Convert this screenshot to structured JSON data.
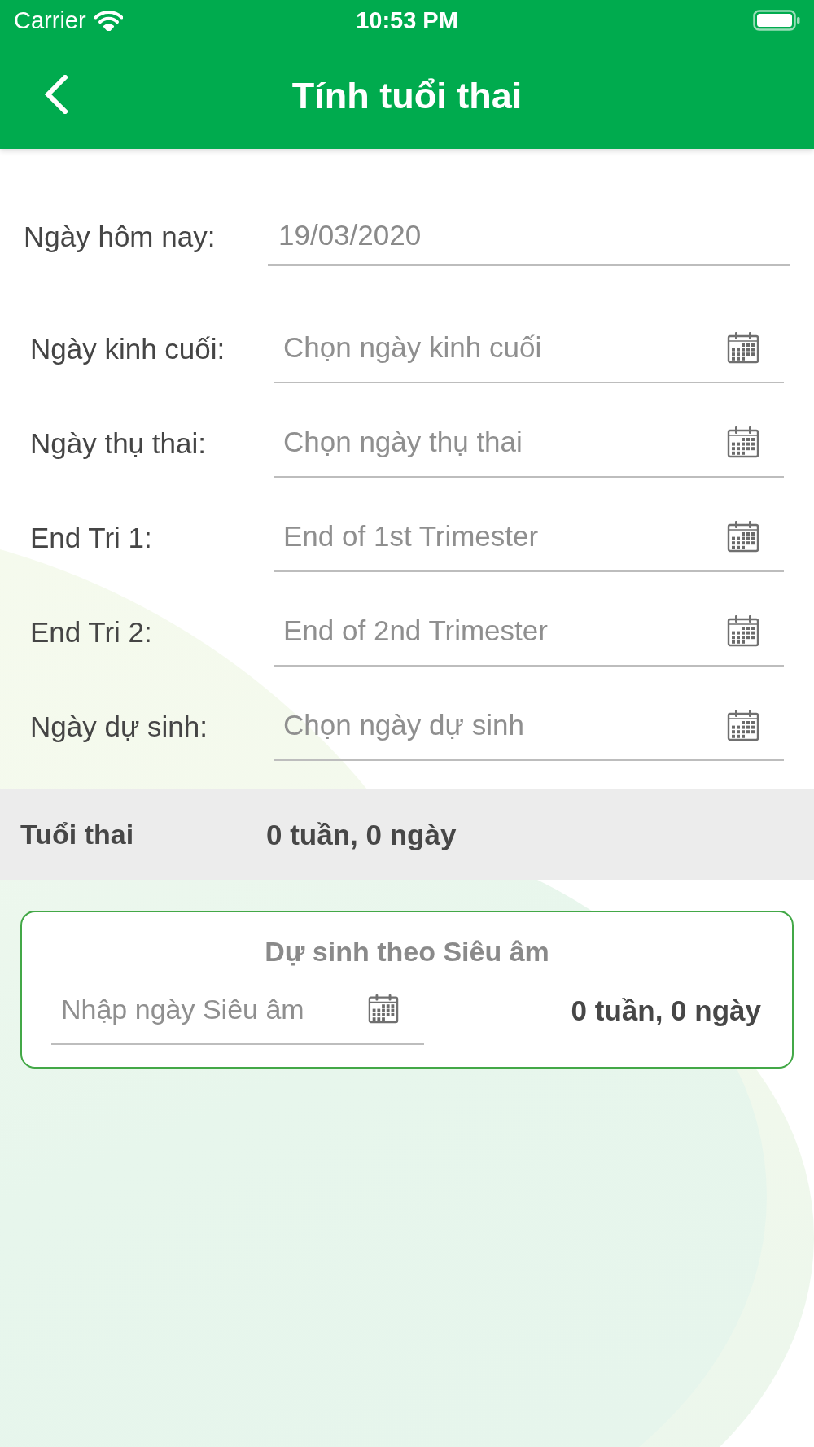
{
  "status_bar": {
    "carrier": "Carrier",
    "time": "10:53 PM"
  },
  "header": {
    "title": "Tính tuổi thai"
  },
  "today": {
    "label": "Ngày hôm nay:",
    "value": "19/03/2020"
  },
  "date_fields": [
    {
      "label": "Ngày kinh cuối:",
      "placeholder": "Chọn ngày kinh cuối"
    },
    {
      "label": "Ngày thụ thai:",
      "placeholder": "Chọn ngày thụ thai"
    },
    {
      "label": "End Tri 1:",
      "placeholder": "End of 1st Trimester"
    },
    {
      "label": "End Tri 2:",
      "placeholder": "End of 2nd Trimester"
    },
    {
      "label": "Ngày dự sinh:",
      "placeholder": "Chọn ngày dự sinh"
    }
  ],
  "summary": {
    "label": "Tuổi thai",
    "value": "0 tuần, 0 ngày"
  },
  "ultrasound_card": {
    "title": "Dự sinh theo Siêu âm",
    "placeholder": "Nhập ngày Siêu âm",
    "result": "0 tuần, 0 ngày"
  }
}
